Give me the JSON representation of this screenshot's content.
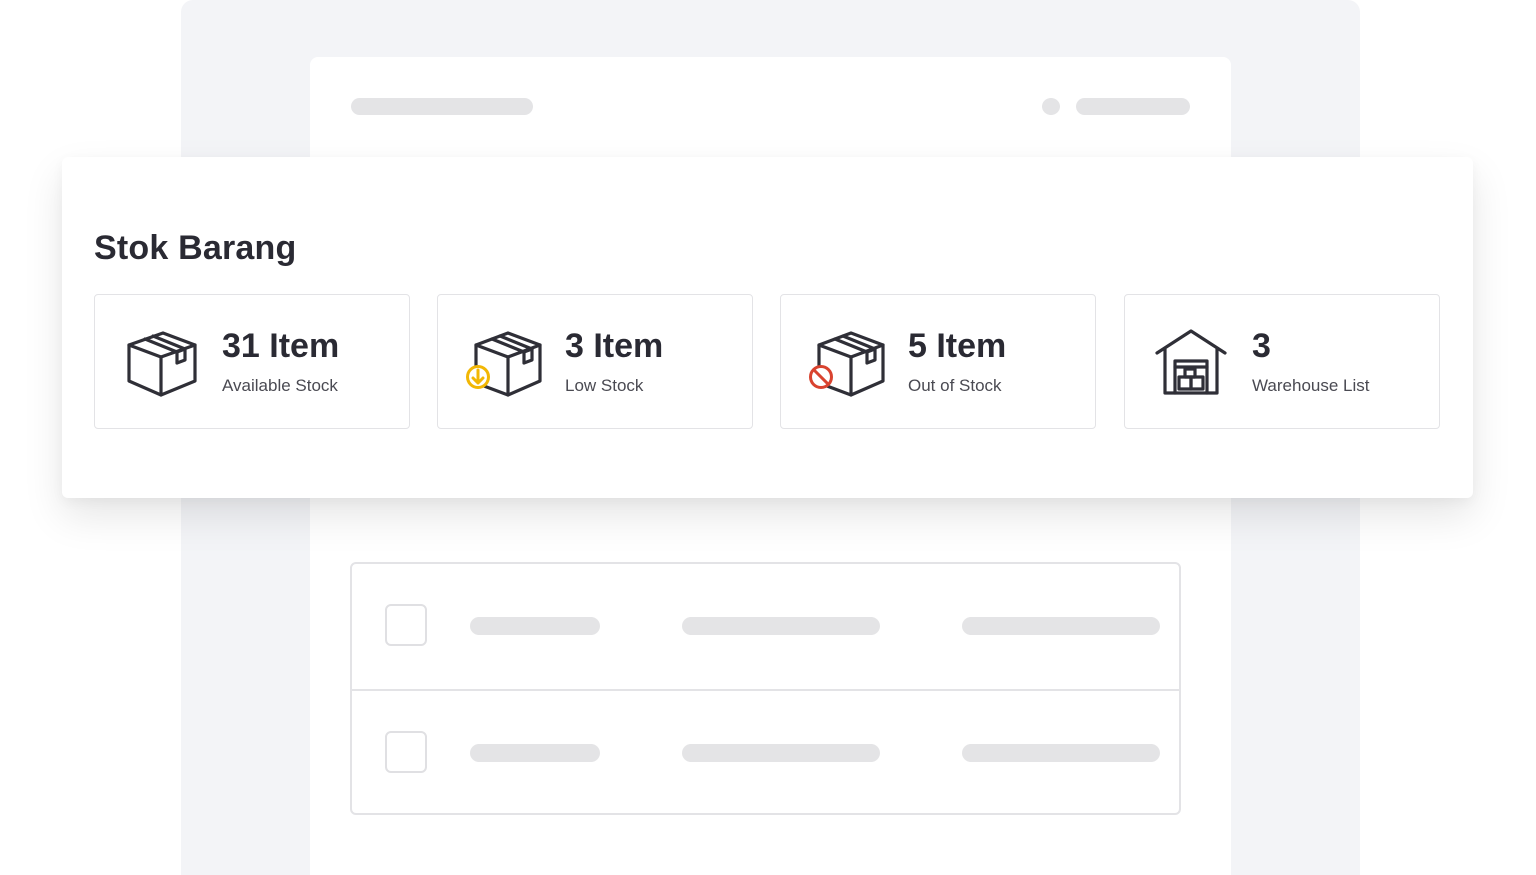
{
  "stock": {
    "title": "Stok Barang",
    "tiles": [
      {
        "value": "31 Item",
        "label": "Available Stock",
        "icon": "box-icon"
      },
      {
        "value": "3 Item",
        "label": "Low Stock",
        "icon": "box-low-stock-icon",
        "badge_color": "#f2b705"
      },
      {
        "value": "5 Item",
        "label": "Out of Stock",
        "icon": "box-out-of-stock-icon",
        "badge_color": "#d9432f"
      },
      {
        "value": "3",
        "label": "Warehouse List",
        "icon": "warehouse-icon"
      }
    ]
  },
  "colors": {
    "text_primary": "#2a2a33",
    "icon_stroke": "#2f2f37",
    "skeleton": "#e4e4e6",
    "background": "#f3f4f7"
  }
}
